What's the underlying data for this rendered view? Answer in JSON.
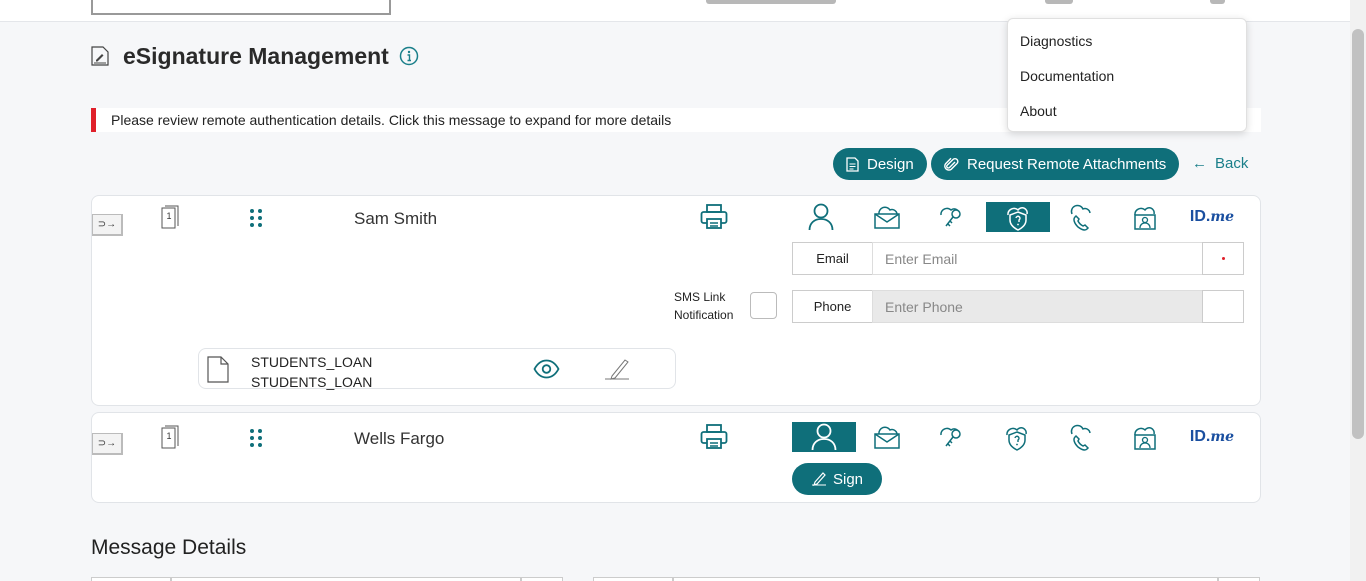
{
  "page": {
    "title": "eSignature Management"
  },
  "alert": {
    "text": "Please review remote authentication details. Click this message to expand for more details",
    "color": "#e0202a"
  },
  "toolbar": {
    "design_label": "Design",
    "request_label": "Request Remote Attachments",
    "back_label": "Back",
    "accent": "#0f6f7a"
  },
  "dropdown": {
    "items": [
      "Diagnostics",
      "Documentation",
      "About"
    ]
  },
  "signers": [
    {
      "order": "1",
      "name": "Sam Smith",
      "active_auth": "kba-icon",
      "email_label": "Email",
      "email_placeholder": "Enter Email",
      "sms_label_line1": "SMS Link",
      "sms_label_line2": "Notification",
      "phone_label": "Phone",
      "phone_placeholder": "Enter Phone",
      "documents": [
        "STUDENTS_LOAN",
        "STUDENTS_LOAN"
      ]
    },
    {
      "order": "1",
      "name": "Wells Fargo",
      "active_auth": "in-person-icon",
      "sign_label": "Sign"
    }
  ],
  "auth_icons": [
    "in-person-icon",
    "email-auth-icon",
    "access-code-icon",
    "kba-icon",
    "phone-auth-icon",
    "id-check-icon",
    "idme-icon"
  ],
  "idme": {
    "id": "ID.",
    "me": "me"
  },
  "sections": {
    "message_details": "Message Details"
  }
}
